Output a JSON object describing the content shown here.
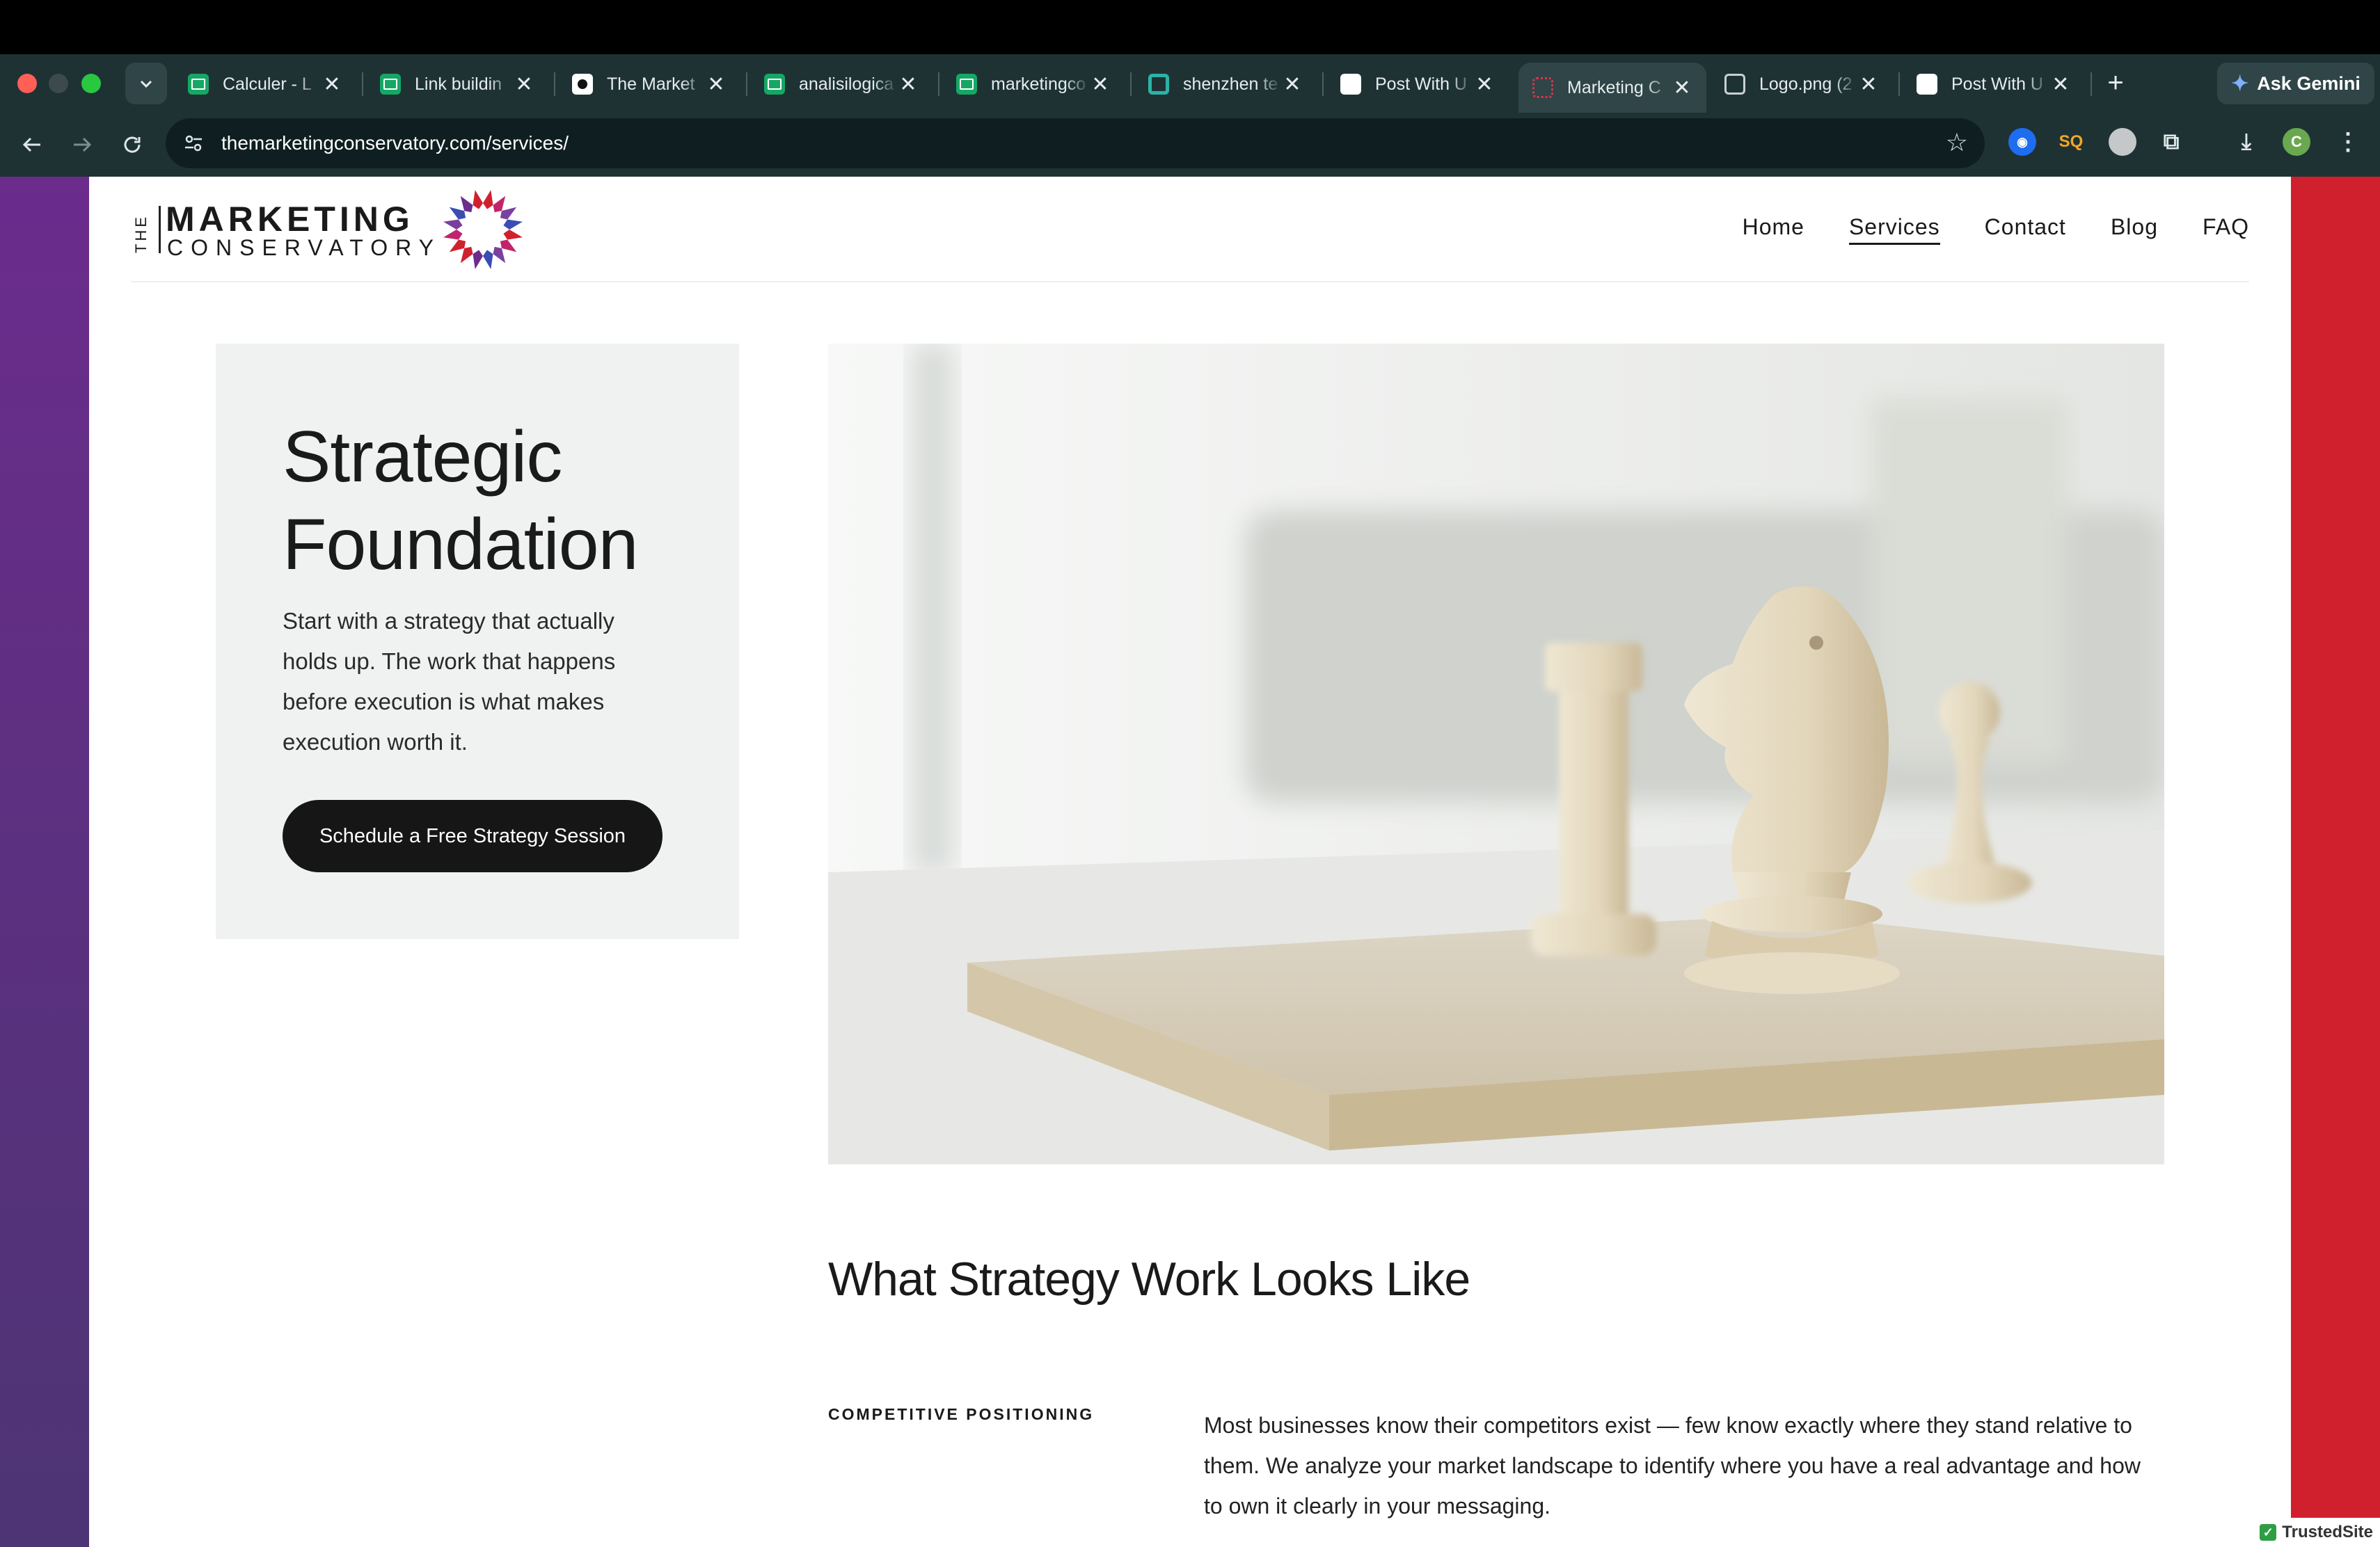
{
  "browser": {
    "tabs": [
      {
        "title": "Calculer - L",
        "favicon": "sheets-icon"
      },
      {
        "title": "Link buildin",
        "favicon": "sheets-icon"
      },
      {
        "title": "The Market",
        "favicon": "notion-icon"
      },
      {
        "title": "analisilogica",
        "favicon": "sheets-icon"
      },
      {
        "title": "marketingco",
        "favicon": "sheets-icon"
      },
      {
        "title": "shenzhen te",
        "favicon": "ring-icon"
      },
      {
        "title": "Post With U",
        "favicon": "openai-icon"
      },
      {
        "title": "Marketing C",
        "favicon": "conservatory-icon",
        "active": true
      },
      {
        "title": "Logo.png (2",
        "favicon": "globe-icon"
      },
      {
        "title": "Post With U",
        "favicon": "openai-icon"
      }
    ],
    "close_glyph": "✕",
    "new_tab": "+",
    "gemini_label": "Ask Gemini",
    "url": "themarketingconservatory.com/services/",
    "profile_initial": "C"
  },
  "site": {
    "logo": {
      "the": "THE",
      "line1": "MARKETING",
      "line2": "CONSERVATORY"
    },
    "nav": [
      "Home",
      "Services",
      "Contact",
      "Blog",
      "FAQ"
    ],
    "active_nav": "Services"
  },
  "hero": {
    "title_line1": "Strategic",
    "title_line2": "Foundation",
    "text": "Start with a strategy that actually holds up. The work that happens before execution is what makes execution worth it.",
    "button": "Schedule a Free Strategy Session"
  },
  "section": {
    "title": "What Strategy Work Looks Like",
    "features": [
      {
        "label": "COMPETITIVE POSITIONING",
        "text": "Most businesses know their competitors exist — few know exactly where they stand relative to them. We analyze your market landscape to identify where you have a real advantage and how to own it clearly in your messaging."
      }
    ]
  },
  "badge": "TrustedSite",
  "colors": {
    "brand_purple": "#6b2c8c",
    "brand_red": "#d0202e",
    "chrome_bg": "#1e3234",
    "button_bg": "#161616"
  }
}
